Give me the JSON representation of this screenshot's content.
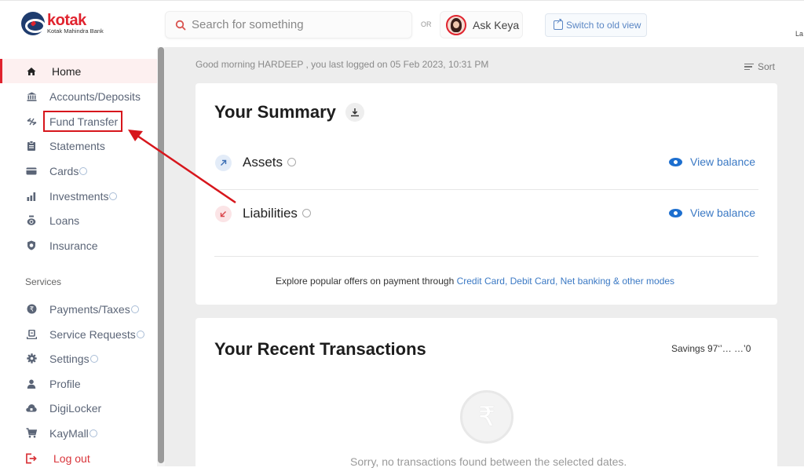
{
  "header": {
    "logo_brand": "kotak",
    "logo_sub": "Kotak Mahindra Bank",
    "search_placeholder": "Search for something",
    "or_label": "OR",
    "ask_keya_label": "Ask Keya",
    "switch_label": "Switch to old view",
    "language_label": "La"
  },
  "sidebar": {
    "items": [
      {
        "label": "Home",
        "icon": "home-icon",
        "active": true
      },
      {
        "label": "Accounts/Deposits",
        "icon": "bank-icon"
      },
      {
        "label": "Fund Transfer",
        "icon": "transfer-icon",
        "highlighted": true
      },
      {
        "label": "Statements",
        "icon": "clipboard-icon"
      },
      {
        "label": "Cards",
        "icon": "card-icon",
        "info": true
      },
      {
        "label": "Investments",
        "icon": "bar-chart-icon",
        "info": true
      },
      {
        "label": "Loans",
        "icon": "money-bag-icon"
      },
      {
        "label": "Insurance",
        "icon": "shield-icon"
      }
    ],
    "services_heading": "Services",
    "service_items": [
      {
        "label": "Payments/Taxes",
        "icon": "rupee-circle-icon",
        "info": true
      },
      {
        "label": "Service Requests",
        "icon": "service-desk-icon",
        "info": true
      },
      {
        "label": "Settings",
        "icon": "gear-icon",
        "info": true
      },
      {
        "label": "Profile",
        "icon": "person-icon"
      },
      {
        "label": "DigiLocker",
        "icon": "cloud-lock-icon"
      },
      {
        "label": "KayMall",
        "icon": "cart-icon",
        "info": true
      }
    ],
    "logout_label": "Log out"
  },
  "main": {
    "greeting": "Good morning HARDEEP , you last logged on 05 Feb 2023, 10:31 PM",
    "sort_label": "Sort",
    "summary": {
      "title": "Your Summary",
      "rows": [
        {
          "label": "Assets",
          "action": "View balance"
        },
        {
          "label": "Liabilities",
          "action": "View balance"
        }
      ],
      "offers_prefix": "Explore popular offers on payment through ",
      "offers_link": "Credit Card, Debit Card, Net banking & other modes"
    },
    "transactions": {
      "title": "Your Recent Transactions",
      "account_label": "Savings 97‘’… …’0",
      "empty_message": "Sorry, no transactions found between the selected dates."
    }
  },
  "colors": {
    "brand_red": "#e0232e",
    "link_blue": "#3b79c4",
    "annotation_red": "#d7161c"
  }
}
